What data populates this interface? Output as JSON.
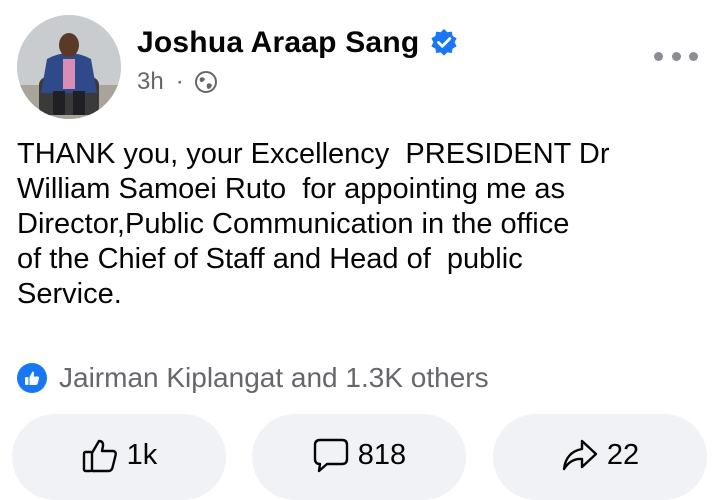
{
  "author": {
    "name": "Joshua Araap Sang",
    "verified": true,
    "time": "3h",
    "separator": "·",
    "audience_icon": "globe-icon"
  },
  "post": {
    "text": "THANK you, your Excellency  PRESIDENT Dr\nWilliam Samoei Ruto  for appointing me as\nDirector,Public Communication in the office\nof the Chief of Staff and Head of  public\nService."
  },
  "reactions": {
    "icon": "like-badge-icon",
    "summary": "Jairman Kiplangat and 1.3K others"
  },
  "actions": {
    "like": {
      "icon": "thumbs-up-icon",
      "count": "1k"
    },
    "comment": {
      "icon": "comment-icon",
      "count": "818"
    },
    "share": {
      "icon": "share-icon",
      "count": "22"
    }
  },
  "colors": {
    "accent": "#1877f2",
    "secondary_text": "#65676b",
    "button_bg": "#f0f2f5"
  }
}
